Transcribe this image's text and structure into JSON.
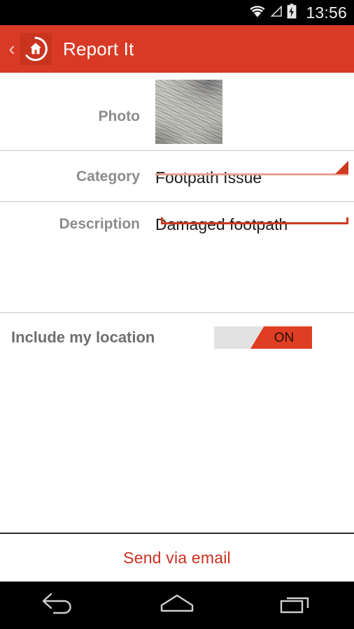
{
  "status_bar": {
    "time": "13:56",
    "icons": [
      {
        "name": "wifi-icon",
        "label": "wifi"
      },
      {
        "name": "signal-icon",
        "label": "cellular-signal"
      },
      {
        "name": "battery-charging-icon",
        "label": "battery-charging"
      }
    ]
  },
  "app_bar": {
    "back_label": "‹",
    "logo_name": "app-home-logo",
    "title": "Report It",
    "background_color": "#d93a26"
  },
  "form": {
    "photo": {
      "label": "Photo",
      "thumbnail_alt": "concrete pavement texture"
    },
    "category": {
      "label": "Category",
      "value": "Footpath Issue",
      "underline_color": "#e8a294",
      "arrow_color": "#cf3a21"
    },
    "description": {
      "label": "Description",
      "value": "Damaged footpath",
      "underline_color": "#cf3a21"
    },
    "location": {
      "label": "Include my location",
      "toggle_state": "ON",
      "toggle_on_color": "#e03e22",
      "toggle_off_color": "#e2e2e2"
    }
  },
  "submit": {
    "label": "Send via email",
    "color": "#cc2f20"
  },
  "nav_bar": {
    "buttons": [
      {
        "name": "nav-back-button",
        "label": "Back"
      },
      {
        "name": "nav-home-button",
        "label": "Home"
      },
      {
        "name": "nav-recents-button",
        "label": "Recent apps"
      }
    ]
  }
}
